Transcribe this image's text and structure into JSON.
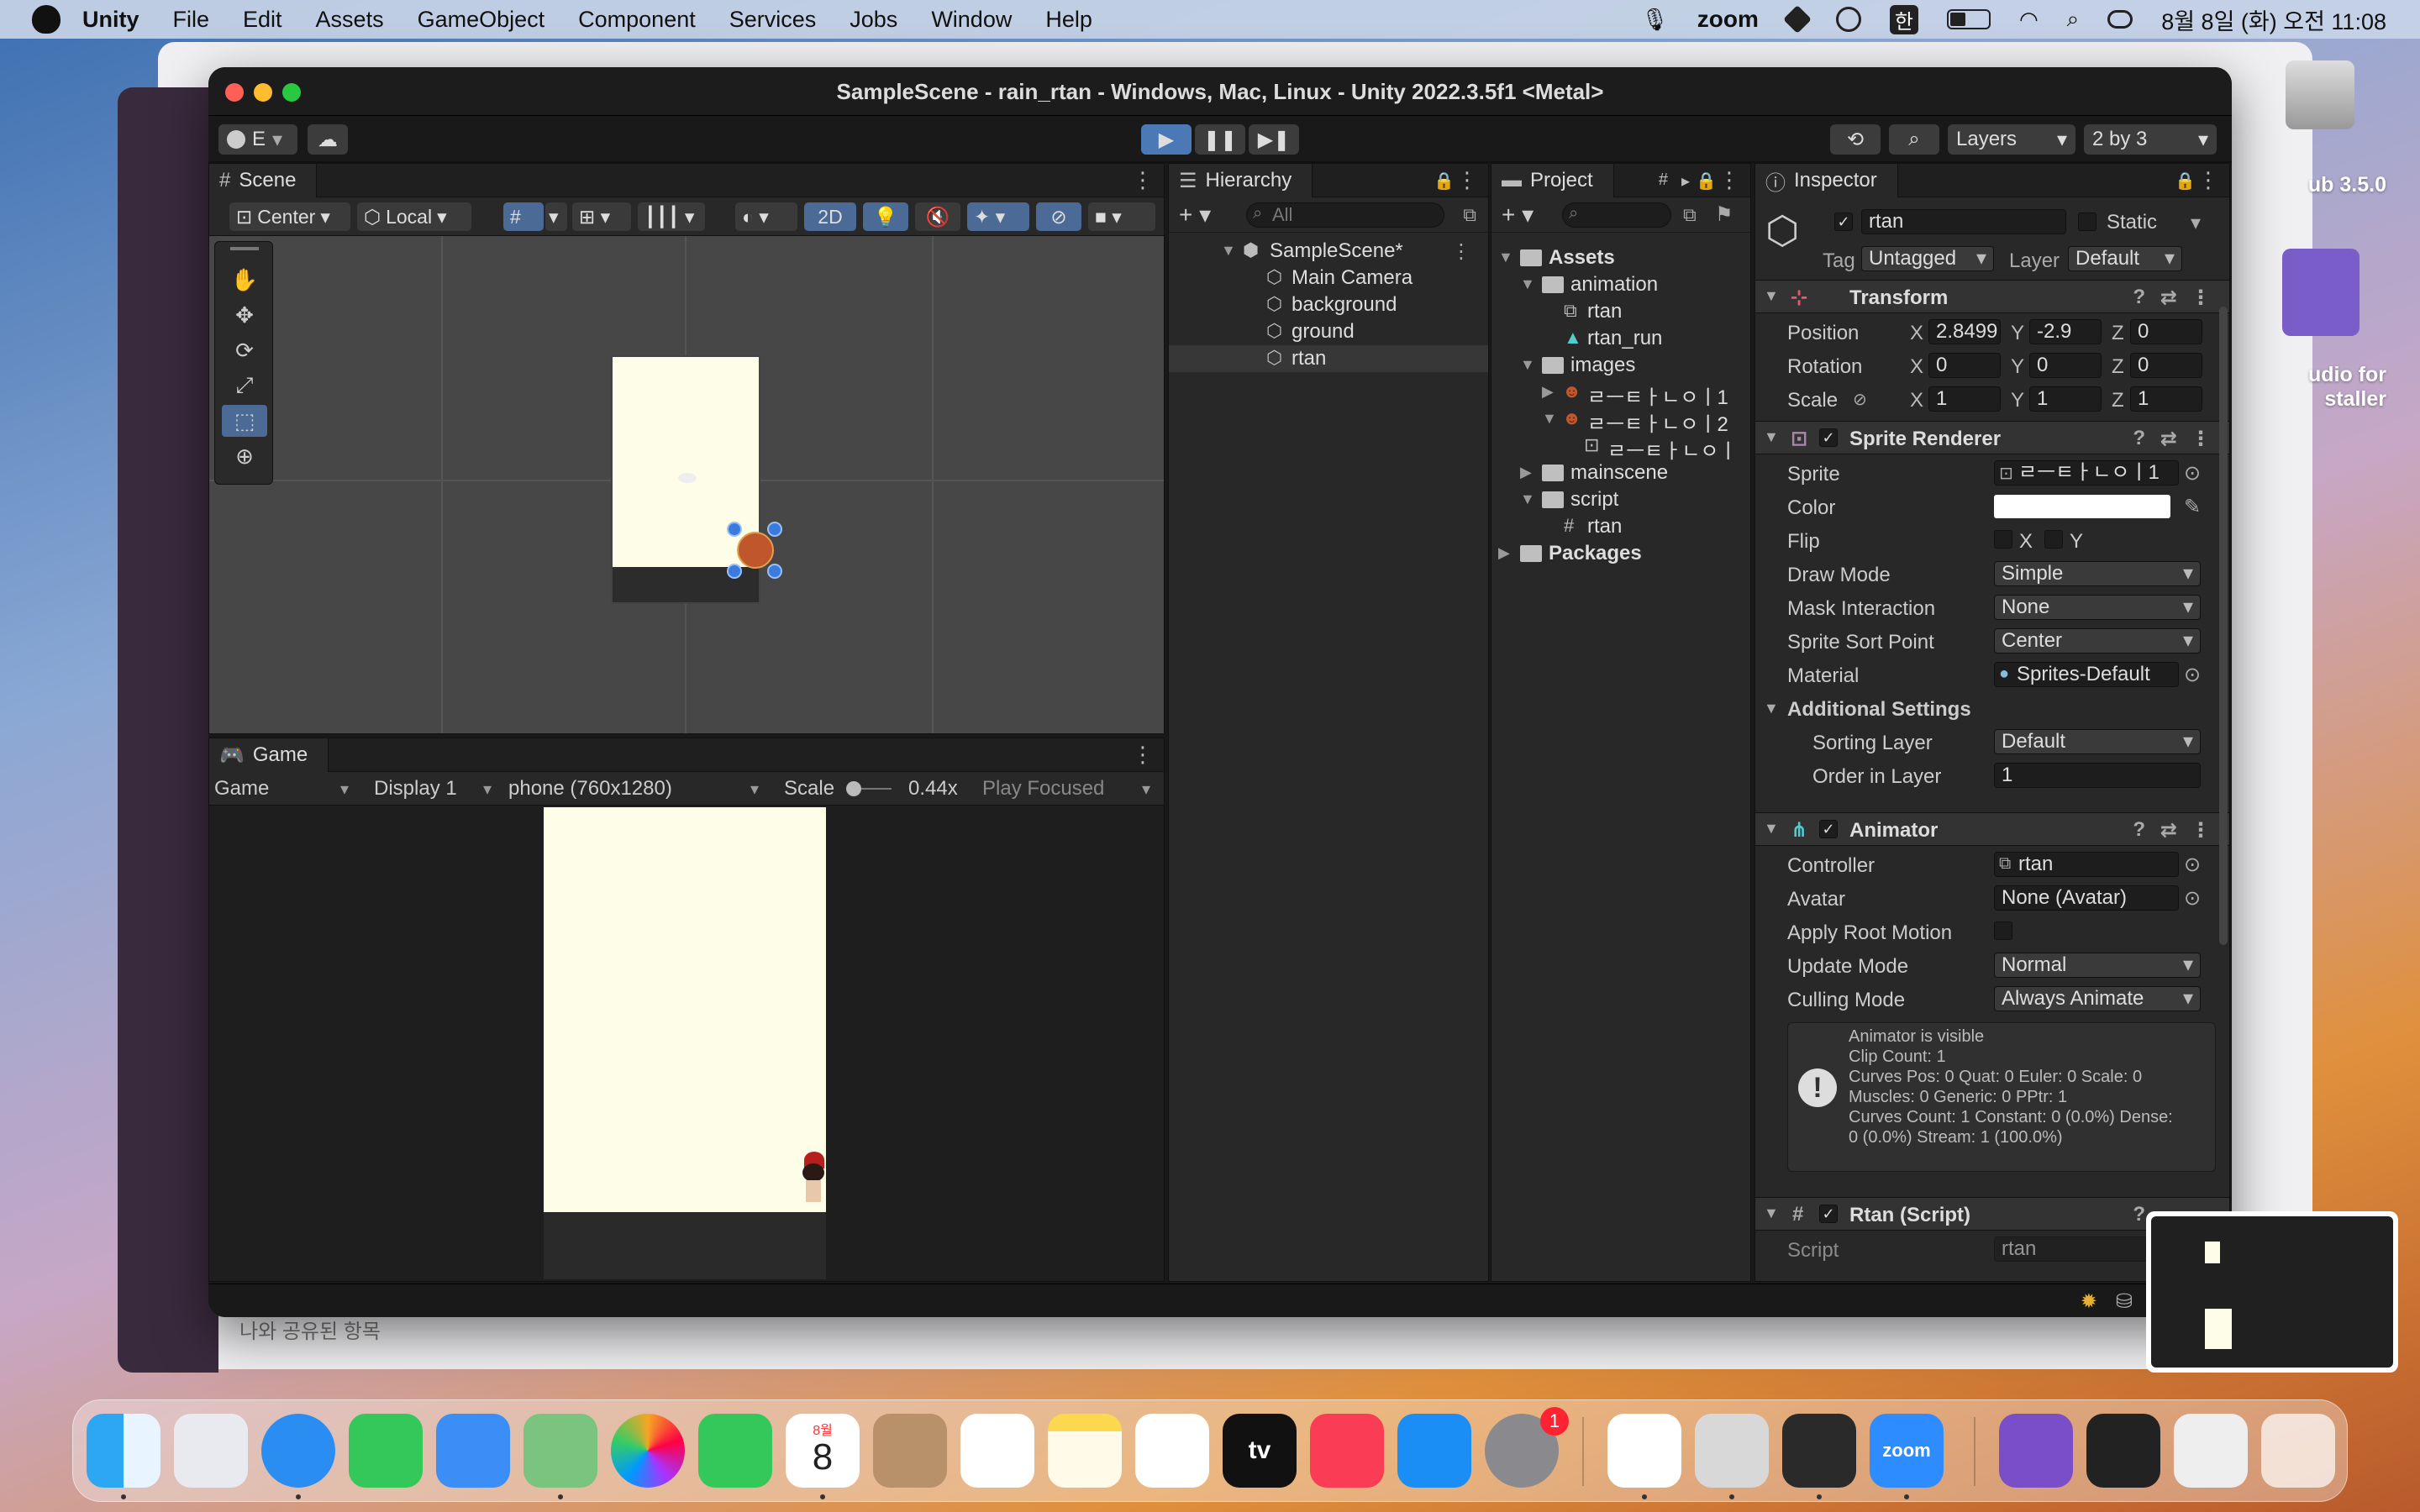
{
  "menubar": {
    "app": "Unity",
    "items": [
      "File",
      "Edit",
      "Assets",
      "GameObject",
      "Component",
      "Services",
      "Jobs",
      "Window",
      "Help"
    ],
    "zoom_label": "zoom",
    "input_method": "한",
    "datetime": "8월 8일 (화) 오전 11:08"
  },
  "window": {
    "title": "SampleScene - rain_rtan - Windows, Mac, Linux - Unity 2022.3.5f1 <Metal>"
  },
  "toolbar": {
    "account_label": "E",
    "layers_label": "Layers",
    "layout_label": "2 by 3"
  },
  "scene": {
    "tab_label": "Scene",
    "pivot_label": "Center",
    "space_label": "Local",
    "mode_2d": "2D"
  },
  "game": {
    "tab_label": "Game",
    "mode": "Game",
    "display": "Display 1",
    "resolution": "phone (760x1280)",
    "scale_label": "Scale",
    "scale_value": "0.44x",
    "play_focused": "Play Focused"
  },
  "hierarchy": {
    "tab_label": "Hierarchy",
    "search_placeholder": "All",
    "scene_name": "SampleScene*",
    "objects": [
      "Main Camera",
      "background",
      "ground",
      "rtan"
    ]
  },
  "project": {
    "tab_label": "Project",
    "tree": [
      {
        "label": "Assets",
        "depth": 0,
        "kind": "folder",
        "open": true,
        "bold": true
      },
      {
        "label": "animation",
        "depth": 1,
        "kind": "folder",
        "open": true
      },
      {
        "label": "rtan",
        "depth": 2,
        "kind": "controller"
      },
      {
        "label": "rtan_run",
        "depth": 2,
        "kind": "clip"
      },
      {
        "label": "images",
        "depth": 1,
        "kind": "folder",
        "open": true
      },
      {
        "label": "ㄹㅡㅌㅏㄴㅇㅣ1",
        "depth": 2,
        "kind": "image",
        "collapsed": true
      },
      {
        "label": "ㄹㅡㅌㅏㄴㅇㅣ2",
        "depth": 2,
        "kind": "image",
        "open": true
      },
      {
        "label": "ㄹㅡㅌㅏㄴㅇㅣ",
        "depth": 3,
        "kind": "sprite"
      },
      {
        "label": "mainscene",
        "depth": 1,
        "kind": "folder",
        "collapsed": true
      },
      {
        "label": "script",
        "depth": 1,
        "kind": "folder",
        "open": true
      },
      {
        "label": "rtan",
        "depth": 2,
        "kind": "script"
      },
      {
        "label": "Packages",
        "depth": 0,
        "kind": "folder",
        "collapsed": true,
        "bold": true
      }
    ]
  },
  "inspector": {
    "tab_label": "Inspector",
    "object_name": "rtan",
    "static_label": "Static",
    "tag_label": "Tag",
    "tag_value": "Untagged",
    "layer_label": "Layer",
    "layer_value": "Default",
    "transform": {
      "title": "Transform",
      "position_label": "Position",
      "position": {
        "x": "2.8499",
        "y": "-2.9",
        "z": "0"
      },
      "rotation_label": "Rotation",
      "rotation": {
        "x": "0",
        "y": "0",
        "z": "0"
      },
      "scale_label": "Scale",
      "scale": {
        "x": "1",
        "y": "1",
        "z": "1"
      },
      "axis_x": "X",
      "axis_y": "Y",
      "axis_z": "Z"
    },
    "sprite_renderer": {
      "title": "Sprite Renderer",
      "sprite_label": "Sprite",
      "sprite_value": "ㄹㅡㅌㅏㄴㅇㅣ1",
      "color_label": "Color",
      "flip_label": "Flip",
      "flip_x": "X",
      "flip_y": "Y",
      "draw_mode_label": "Draw Mode",
      "draw_mode": "Simple",
      "mask_label": "Mask Interaction",
      "mask": "None",
      "sort_point_label": "Sprite Sort Point",
      "sort_point": "Center",
      "material_label": "Material",
      "material": "Sprites-Default",
      "additional_label": "Additional Settings",
      "sorting_layer_label": "Sorting Layer",
      "sorting_layer": "Default",
      "order_label": "Order in Layer",
      "order": "1"
    },
    "animator": {
      "title": "Animator",
      "controller_label": "Controller",
      "controller": "rtan",
      "avatar_label": "Avatar",
      "avatar": "None (Avatar)",
      "root_motion_label": "Apply Root Motion",
      "update_mode_label": "Update Mode",
      "update_mode": "Normal",
      "culling_label": "Culling Mode",
      "culling": "Always Animate",
      "info": "Animator is visible\nClip Count: 1\nCurves Pos: 0 Quat: 0 Euler: 0 Scale: 0\nMuscles: 0 Generic: 0 PPtr: 1\nCurves Count: 1 Constant: 0 (0.0%) Dense:\n0 (0.0%) Stream: 1 (100.0%)"
    },
    "script_component": {
      "title": "Rtan (Script)",
      "script_label": "Script",
      "script_value": "rtan"
    }
  },
  "desktop": {
    "item1": "ub 3.5.0",
    "item2": "udio for\nstaller",
    "finder_shared": "나와 공유된 항목"
  },
  "dock": {
    "calendar_month": "8월",
    "calendar_day": "8",
    "settings_badge": "1",
    "zoom_label": "zoom",
    "tv_label": "tv"
  },
  "colors": {
    "play_button": "#4a79b6",
    "selection": "#4b6a96",
    "game_background": "#fdfde8"
  }
}
